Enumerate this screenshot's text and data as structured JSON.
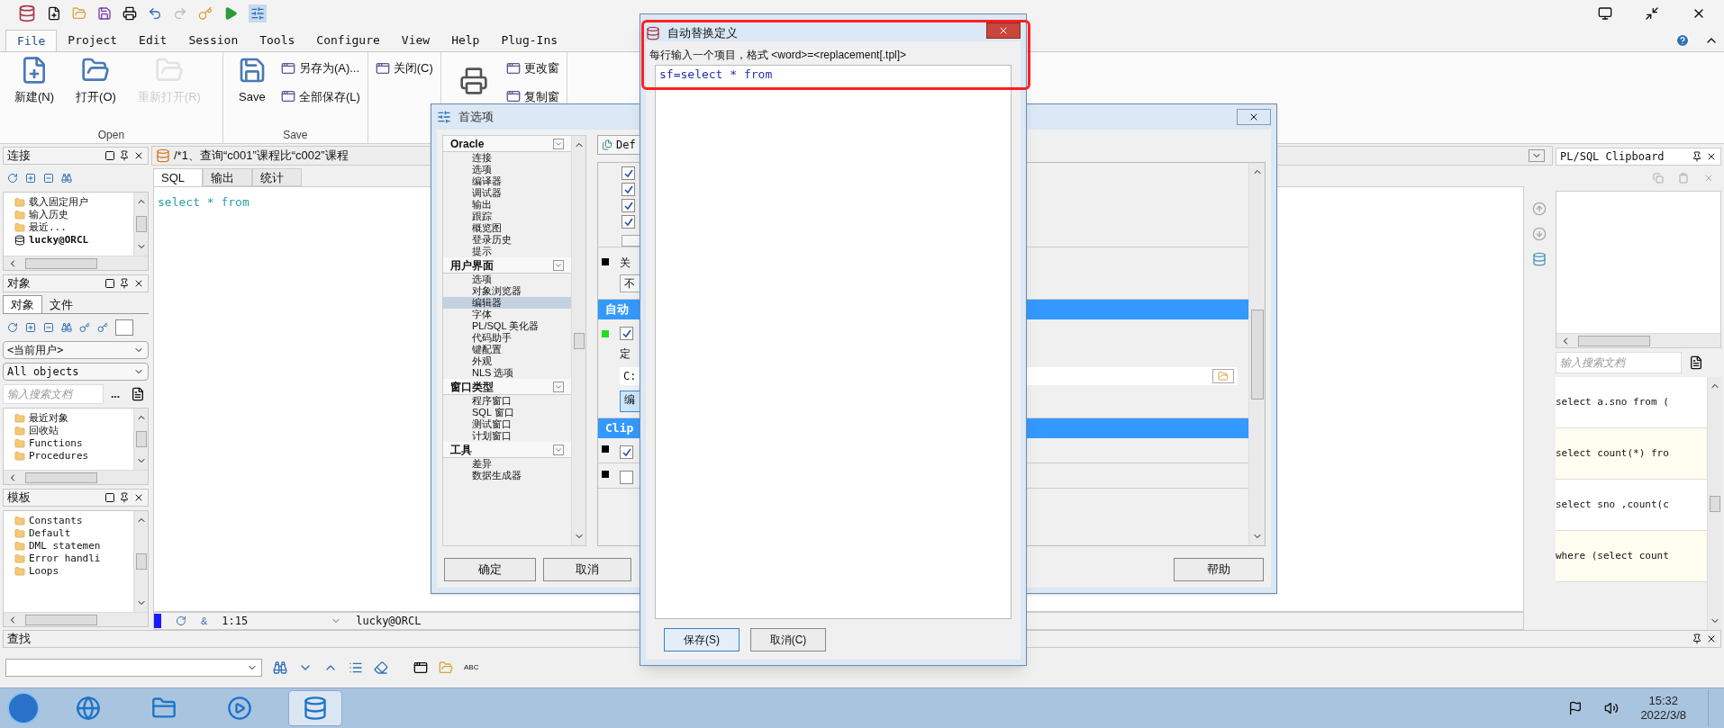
{
  "menu_tabs": [
    {
      "label": "File",
      "selected": true
    },
    {
      "label": "Project",
      "selected": false
    },
    {
      "label": "Edit",
      "selected": false
    },
    {
      "label": "Session",
      "selected": false
    },
    {
      "label": "Tools",
      "selected": false
    },
    {
      "label": "Configure",
      "selected": false
    },
    {
      "label": "View",
      "selected": false
    },
    {
      "label": "Help",
      "selected": false
    },
    {
      "label": "Plug-Ins",
      "selected": false
    }
  ],
  "ribbon": {
    "groups": [
      {
        "label": "Open",
        "items": [
          {
            "kind": "large",
            "label": "新建(N)",
            "disabled": false
          },
          {
            "kind": "large",
            "label": "打开(O)",
            "disabled": false
          },
          {
            "kind": "large",
            "label": "重新打开(R)",
            "disabled": true
          }
        ]
      },
      {
        "label": "Save",
        "items": [
          {
            "kind": "large",
            "label": "Save",
            "disabled": false
          },
          {
            "kind": "small",
            "label": "另存为(A)...",
            "disabled": false
          },
          {
            "kind": "small",
            "label": "全部保存(L)",
            "disabled": false
          }
        ]
      },
      {
        "items": [
          {
            "kind": "small",
            "label": "关闭(C)",
            "disabled": false
          }
        ]
      },
      {
        "items": [
          {
            "kind": "icon"
          },
          {
            "kind": "small",
            "label": "更改窗",
            "disabled": false
          },
          {
            "kind": "small",
            "label": "复制窗",
            "disabled": false
          }
        ]
      }
    ]
  },
  "connections_panel": {
    "title": "连接",
    "items": [
      {
        "label": "载入固定用户",
        "kind": "folder"
      },
      {
        "label": "输入历史",
        "kind": "folder"
      },
      {
        "label": "最近...",
        "kind": "folder"
      },
      {
        "label": "lucky@ORCL",
        "kind": "db"
      }
    ]
  },
  "objects_panel": {
    "title": "对象",
    "tabs": [
      {
        "label": "对象",
        "selected": true
      },
      {
        "label": "文件",
        "selected": false
      }
    ],
    "owner": "<当前用户>",
    "filter": "All objects",
    "search": {
      "placeholder": "输入搜索文档"
    },
    "more": "...",
    "items": [
      "最近对象",
      "回收站",
      "Functions",
      "Procedures"
    ]
  },
  "templates_panel": {
    "title": "模板",
    "items": [
      "Constants",
      "Default",
      "DML statemen",
      "Error handli",
      "Loops"
    ]
  },
  "editor": {
    "tab_title": "/*1、查询“c001”课程比“c002”课程",
    "subtabs": [
      {
        "label": "SQL",
        "selected": true
      },
      {
        "label": "输出",
        "selected": false
      },
      {
        "label": "统计",
        "selected": false
      }
    ],
    "code": "select * from",
    "status": {
      "symbol": "&",
      "position": "1:15",
      "connection": "lucky@ORCL"
    }
  },
  "clipboard_panel": {
    "title": "PL/SQL Clipboard",
    "search": {
      "placeholder": "输入搜索文档"
    },
    "items": [
      "select a.sno from (",
      "select count(*) fro",
      "select sno ,count(c",
      "where (select count"
    ]
  },
  "find_bar": {
    "title": "查找",
    "abc": "ABC"
  },
  "preferences": {
    "title": "首选项",
    "sections": [
      {
        "label": "Oracle",
        "children": [
          {
            "label": "连接",
            "selected": false
          },
          {
            "label": "选项",
            "selected": false
          },
          {
            "label": "编译器",
            "selected": false
          },
          {
            "label": "调试器",
            "selected": false
          },
          {
            "label": "输出",
            "selected": false
          },
          {
            "label": "跟踪",
            "selected": false
          },
          {
            "label": "概览图",
            "selected": false
          },
          {
            "label": "登录历史",
            "selected": false
          },
          {
            "label": "提示",
            "selected": false
          }
        ]
      },
      {
        "label": "用户界面",
        "children": [
          {
            "label": "选项",
            "selected": false
          },
          {
            "label": "对象浏览器",
            "selected": false
          },
          {
            "label": "编辑器",
            "selected": true
          },
          {
            "label": "字体",
            "selected": false
          },
          {
            "label": "PL/SQL 美化器",
            "selected": false
          },
          {
            "label": "代码助手",
            "selected": false
          },
          {
            "label": "键配置",
            "selected": false
          },
          {
            "label": "外观",
            "selected": false
          },
          {
            "label": "NLS 选项",
            "selected": false
          }
        ]
      },
      {
        "label": "窗口类型",
        "children": [
          {
            "label": "程序窗口",
            "selected": false
          },
          {
            "label": "SQL 窗口",
            "selected": false
          },
          {
            "label": "测试窗口",
            "selected": false
          },
          {
            "label": "计划窗口",
            "selected": false
          }
        ]
      },
      {
        "label": "工具",
        "children": [
          {
            "label": "差异",
            "selected": false
          },
          {
            "label": "数据生成器",
            "selected": false
          }
        ]
      }
    ],
    "preset": "Def",
    "rows": [
      {
        "kind": "check",
        "checked": true
      },
      {
        "kind": "check",
        "checked": true
      },
      {
        "kind": "check",
        "checked": true
      },
      {
        "kind": "check",
        "checked": true
      }
    ],
    "key_label": "关",
    "key_value": "不",
    "band1": "自动",
    "auto_checked": true,
    "define_label": "定",
    "path": "C:",
    "edit_button": "编",
    "band2": "Clip",
    "clip_rows": [
      {
        "checked": true
      },
      {
        "checked": false
      }
    ],
    "buttons": {
      "ok": "确定",
      "cancel": "取消",
      "help": "帮助"
    }
  },
  "autoreplace": {
    "title": "自动替换定义",
    "hint": "每行输入一个项目，格式 <word>=<replacement[.tpl]>",
    "value": "sf=select * from",
    "save": "保存(S)",
    "cancel": "取消(C)"
  },
  "taskbar": {
    "apps": [
      {
        "kind": "ie",
        "active": false
      },
      {
        "kind": "folder",
        "active": false
      },
      {
        "kind": "media",
        "active": false
      },
      {
        "kind": "db",
        "active": true
      }
    ],
    "time": "15:32",
    "date": "2022/3/8"
  }
}
